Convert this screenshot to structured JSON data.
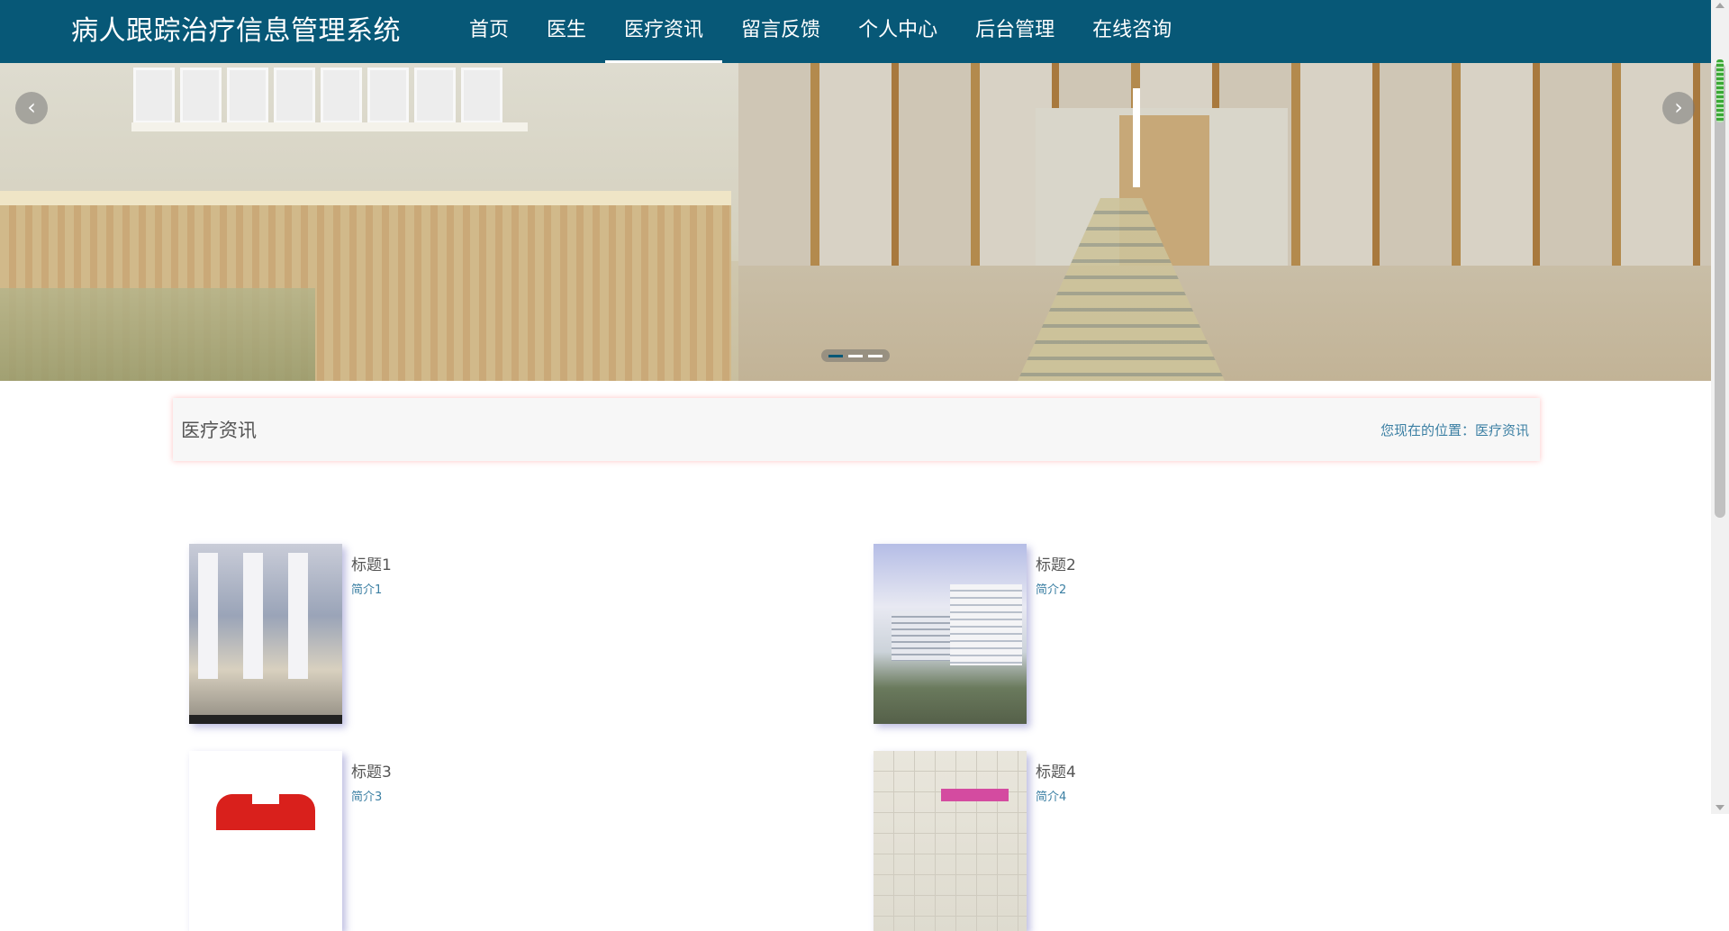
{
  "header": {
    "brand": "病人跟踪治疗信息管理系统",
    "nav": [
      "首页",
      "医生",
      "医疗资讯",
      "留言反馈",
      "个人中心",
      "后台管理",
      "在线咨询"
    ],
    "active_index": 2
  },
  "banner": {
    "prev_icon": "chevron-left-icon",
    "next_icon": "chevron-right-icon",
    "prev_glyph": "‹",
    "next_glyph": "›",
    "slides": 3,
    "active_slide": 0
  },
  "section": {
    "title": "医疗资讯",
    "breadcrumb_prefix": "您现在的位置：",
    "breadcrumb_current": "医疗资讯"
  },
  "news": [
    {
      "title": "标题1",
      "desc": "简介1"
    },
    {
      "title": "标题2",
      "desc": "简介2"
    },
    {
      "title": "标题3",
      "desc": "简介3"
    },
    {
      "title": "标题4",
      "desc": "简介4"
    }
  ],
  "colors": {
    "nav_bg": "#075877",
    "accent_text": "#3b7fa3",
    "section_shadow": "#ff7878"
  }
}
